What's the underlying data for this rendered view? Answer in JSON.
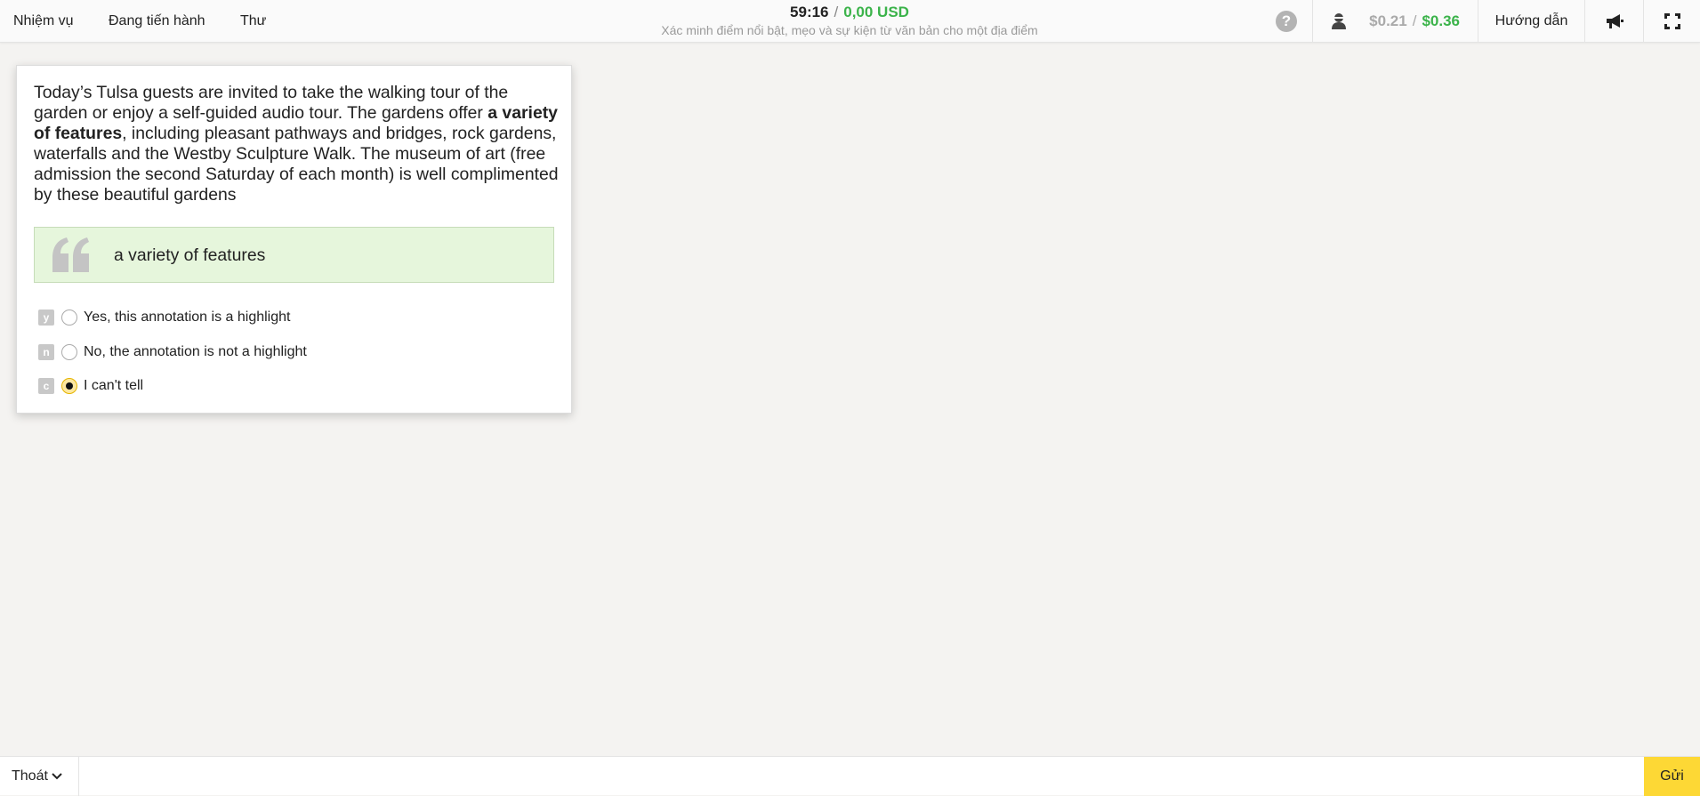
{
  "nav": {
    "items": [
      {
        "label": "Nhiệm vụ"
      },
      {
        "label": "Đang tiến hành"
      },
      {
        "label": "Thư"
      }
    ]
  },
  "header": {
    "timer": "59:16",
    "separator": "/",
    "earnings": "0,00 USD",
    "subtitle": "Xác minh điểm nổi bật, mẹo và sự kiện từ văn bản cho một địa điểm"
  },
  "toolbar": {
    "help_icon": "question-circle-icon",
    "help_glyph": "?",
    "pay_icon": "user-icon",
    "pay_min": "$0.21",
    "pay_separator": "/",
    "pay_max": "$0.36",
    "guide_label": "Hướng dẫn",
    "announce_icon": "megaphone-icon",
    "fullscreen_icon": "fullscreen-icon"
  },
  "task": {
    "passage_before": "Today’s Tulsa guests are invited to take the walking tour of the garden or enjoy a self-guided audio tour. The gardens offer ",
    "passage_highlight": "a variety of features",
    "passage_after": ", including pleasant pathways and bridges, rock gardens, waterfalls and the Westby Sculpture Walk. The museum of art (free admission the second Saturday of each month) is well complimented by these beautiful gardens",
    "quote_icon": "quote-icon",
    "annotation": "a variety of features",
    "options": [
      {
        "key": "y",
        "label": "Yes, this annotation is a highlight",
        "selected": false
      },
      {
        "key": "n",
        "label": "No, the annotation is not a highlight",
        "selected": false
      },
      {
        "key": "c",
        "label": "I can't tell",
        "selected": true
      }
    ]
  },
  "footer": {
    "exit_label": "Thoát",
    "exit_icon": "chevron-down-icon",
    "submit_label": "Gửi"
  },
  "colors": {
    "accent_green": "#3bb34a",
    "submit_yellow": "#fdd835",
    "quote_bg": "#e6f6dc"
  }
}
